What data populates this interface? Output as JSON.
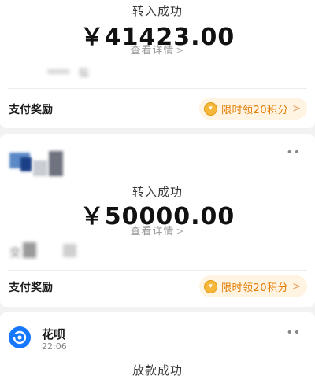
{
  "card1": {
    "status": "转入成功",
    "amount": "￥41423.00",
    "detail_link": "查看详情",
    "blurred_caption": "伝",
    "reward": {
      "label": "支付奖励",
      "promo": "限时领20积分"
    }
  },
  "card2": {
    "status": "转入成功",
    "amount": "￥50000.00",
    "detail_link": "查看详情",
    "blurred_caption": "交",
    "reward": {
      "label": "支付奖励",
      "promo": "限时领20积分"
    }
  },
  "card3": {
    "app_name": "花呗",
    "time": "22:06",
    "status": "放款成功"
  },
  "colors": {
    "accent_orange": "#e07b00",
    "pill_bg": "#fff3e1",
    "brand_blue": "#1677ff"
  },
  "icons": [
    "more-dots-icon",
    "coin-icon",
    "chevron-right-icon",
    "huabei-icon"
  ]
}
